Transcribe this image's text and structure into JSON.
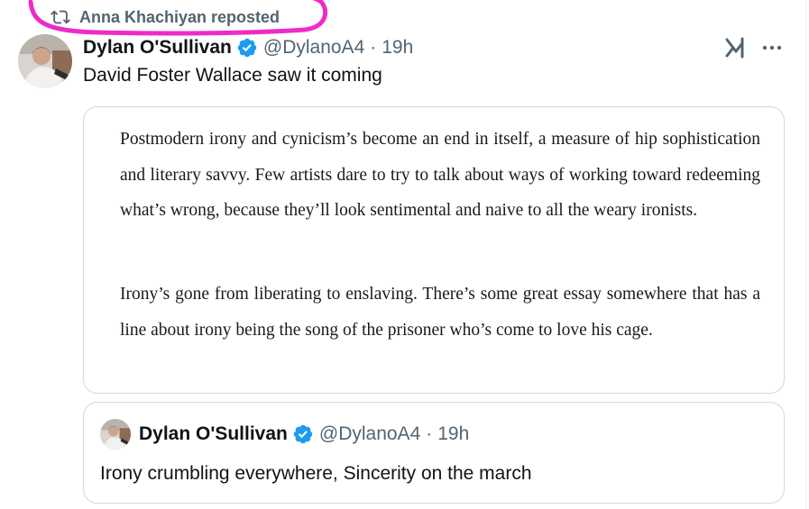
{
  "repost": {
    "icon": "repost-icon",
    "label": "Anna Khachiyan reposted"
  },
  "tweet": {
    "author_name": "Dylan O'Sullivan",
    "handle": "@DylanoA4",
    "separator": "·",
    "time": "19h",
    "text": "David Foster Wallace saw it coming",
    "icons": [
      "verified-badge-icon",
      "grok-icon",
      "more-icon"
    ]
  },
  "media": {
    "paragraphs": [
      "Postmodern irony and cynicism’s become an end in itself, a measure of hip sophistication and literary savvy. Few artists dare to try to talk about ways of working toward redeeming what’s wrong, because they’ll look sentimental and naive to all the weary ironists.",
      "Irony’s gone from liberating to enslaving. There’s some great essay somewhere that has a line about irony being the song of the prisoner who’s come to love his cage."
    ]
  },
  "quoted_tweet": {
    "author_name": "Dylan O'Sullivan",
    "handle": "@DylanoA4",
    "separator": "·",
    "time": "19h",
    "text": "Irony crumbling everywhere, Sincerity on the march"
  },
  "colors": {
    "verified_blue": "#1d9bf0",
    "secondary_text": "#536471",
    "highlight_magenta": "#ee2bc8",
    "border": "#cfd9de"
  }
}
